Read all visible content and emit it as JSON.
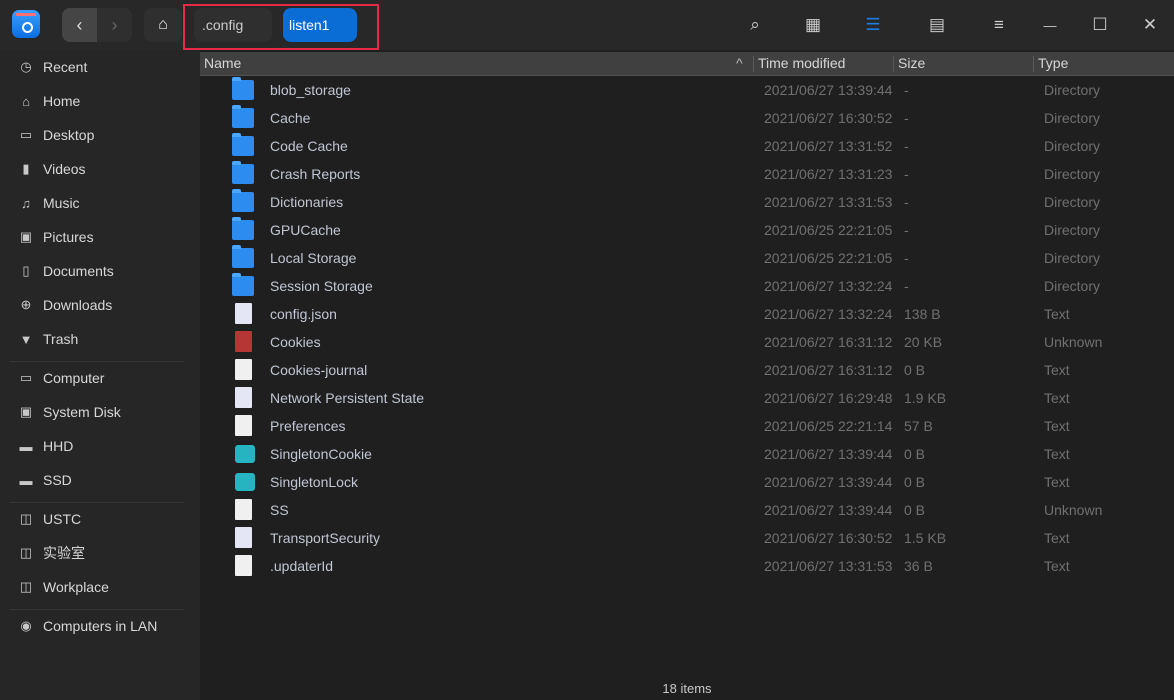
{
  "breadcrumb": [
    ".config",
    "listen1"
  ],
  "toolbar": {
    "back_icon": "‹",
    "forward_icon": "›",
    "home_icon": "⌂",
    "search": "⌕",
    "icon_view": "▦",
    "list_view": "☰",
    "detail_view": "▤",
    "menu": "≡",
    "minimize": "—",
    "maximize": "☐",
    "close": "✕"
  },
  "colors": {
    "accent": "#0a6dd6",
    "highlight_border": "#e8294a"
  },
  "sidebar": {
    "groups": [
      [
        {
          "label": "Recent",
          "icon": "◷"
        },
        {
          "label": "Home",
          "icon": "⌂"
        },
        {
          "label": "Desktop",
          "icon": "▭"
        },
        {
          "label": "Videos",
          "icon": "▮"
        },
        {
          "label": "Music",
          "icon": "♫"
        },
        {
          "label": "Pictures",
          "icon": "▣"
        },
        {
          "label": "Documents",
          "icon": "▯"
        },
        {
          "label": "Downloads",
          "icon": "⊕"
        },
        {
          "label": "Trash",
          "icon": "▼"
        }
      ],
      [
        {
          "label": "Computer",
          "icon": "▭"
        },
        {
          "label": "System Disk",
          "icon": "▣"
        },
        {
          "label": "HHD",
          "icon": "▬"
        },
        {
          "label": "SSD",
          "icon": "▬"
        }
      ],
      [
        {
          "label": "USTC",
          "icon": "◫"
        },
        {
          "label": "实验室",
          "icon": "◫"
        },
        {
          "label": "Workplace",
          "icon": "◫"
        }
      ],
      [
        {
          "label": "Computers in LAN",
          "icon": "◉"
        }
      ]
    ]
  },
  "columns": {
    "name": "Name",
    "time": "Time modified",
    "size": "Size",
    "type": "Type",
    "sort_icon": "^"
  },
  "files": [
    {
      "name": "blob_storage",
      "time": "2021/06/27 13:39:44",
      "size": "-",
      "type": "Directory",
      "icon": "folder"
    },
    {
      "name": "Cache",
      "time": "2021/06/27 16:30:52",
      "size": "-",
      "type": "Directory",
      "icon": "folder"
    },
    {
      "name": "Code Cache",
      "time": "2021/06/27 13:31:52",
      "size": "-",
      "type": "Directory",
      "icon": "folder"
    },
    {
      "name": "Crash Reports",
      "time": "2021/06/27 13:31:23",
      "size": "-",
      "type": "Directory",
      "icon": "folder"
    },
    {
      "name": "Dictionaries",
      "time": "2021/06/27 13:31:53",
      "size": "-",
      "type": "Directory",
      "icon": "folder"
    },
    {
      "name": "GPUCache",
      "time": "2021/06/25 22:21:05",
      "size": "-",
      "type": "Directory",
      "icon": "folder"
    },
    {
      "name": "Local Storage",
      "time": "2021/06/25 22:21:05",
      "size": "-",
      "type": "Directory",
      "icon": "folder"
    },
    {
      "name": "Session Storage",
      "time": "2021/06/27 13:32:24",
      "size": "-",
      "type": "Directory",
      "icon": "folder"
    },
    {
      "name": "config.json",
      "time": "2021/06/27 13:32:24",
      "size": "138 B",
      "type": "Text",
      "icon": "text-file"
    },
    {
      "name": "Cookies",
      "time": "2021/06/27 16:31:12",
      "size": "20 KB",
      "type": "Unknown",
      "icon": "database-file"
    },
    {
      "name": "Cookies-journal",
      "time": "2021/06/27 16:31:12",
      "size": "0 B",
      "type": "Text",
      "icon": "blank-file"
    },
    {
      "name": "Network Persistent State",
      "time": "2021/06/27 16:29:48",
      "size": "1.9 KB",
      "type": "Text",
      "icon": "text-file"
    },
    {
      "name": "Preferences",
      "time": "2021/06/25 22:21:14",
      "size": "57 B",
      "type": "Text",
      "icon": "blank-file"
    },
    {
      "name": "SingletonCookie",
      "time": "2021/06/27 13:39:44",
      "size": "0 B",
      "type": "Text",
      "icon": "symlink-locked"
    },
    {
      "name": "SingletonLock",
      "time": "2021/06/27 13:39:44",
      "size": "0 B",
      "type": "Text",
      "icon": "symlink-locked"
    },
    {
      "name": "SS",
      "time": "2021/06/27 13:39:44",
      "size": "0 B",
      "type": "Unknown",
      "icon": "symlink-file"
    },
    {
      "name": "TransportSecurity",
      "time": "2021/06/27 16:30:52",
      "size": "1.5 KB",
      "type": "Text",
      "icon": "text-file"
    },
    {
      "name": ".updaterId",
      "time": "2021/06/27 13:31:53",
      "size": "36 B",
      "type": "Text",
      "icon": "blank-file"
    }
  ],
  "status": "18 items"
}
